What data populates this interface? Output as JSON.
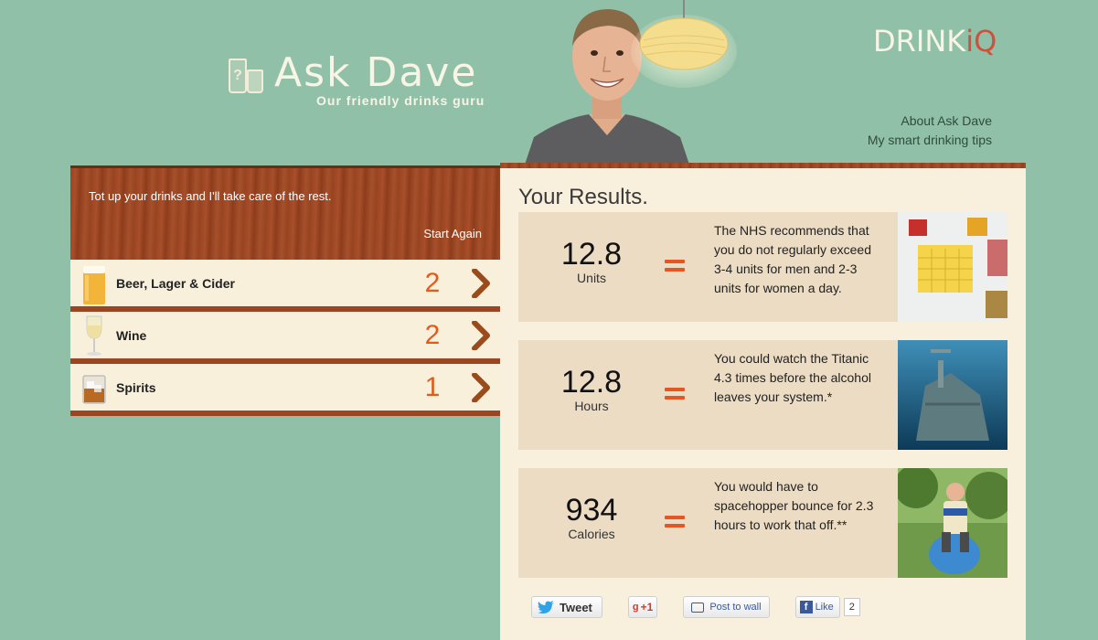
{
  "header": {
    "logo_title": "Ask Dave",
    "logo_subtitle": "Our friendly drinks guru",
    "brand_drink": "DRINK",
    "brand_iq": "iQ",
    "nav_links": [
      "About Ask Dave",
      "My smart drinking tips"
    ]
  },
  "left_panel": {
    "intro": "Tot up your drinks and I'll take care of the rest.",
    "start_again": "Start Again",
    "drinks": [
      {
        "name": "Beer, Lager & Cider",
        "count": "2",
        "icon": "beer-glass-icon"
      },
      {
        "name": "Wine",
        "count": "2",
        "icon": "wine-glass-icon"
      },
      {
        "name": "Spirits",
        "count": "1",
        "icon": "spirits-glass-icon"
      }
    ]
  },
  "results": {
    "title": "Your Results.",
    "items": [
      {
        "value": "12.8",
        "unit": "Units",
        "text": "The NHS recommends that you do not regularly exceed 3-4 units for men and 2-3 units for women a day."
      },
      {
        "value": "12.8",
        "unit": "Hours",
        "text": "You could watch the Titanic 4.3 times before the alcohol leaves your system.*"
      },
      {
        "value": "934",
        "unit": "Calories",
        "text": "You would have to spacehopper bounce for 2.3 hours to work that off.**"
      }
    ]
  },
  "social": {
    "tweet": "Tweet",
    "gplus": "+1",
    "post_to_wall": "Post to wall",
    "like": "Like",
    "like_count": "2"
  },
  "colors": {
    "background": "#90c1a8",
    "accent_orange": "#e25a1c",
    "wood": "#9b4522",
    "panel": "#f9efdd",
    "card": "#ecdcc3"
  }
}
